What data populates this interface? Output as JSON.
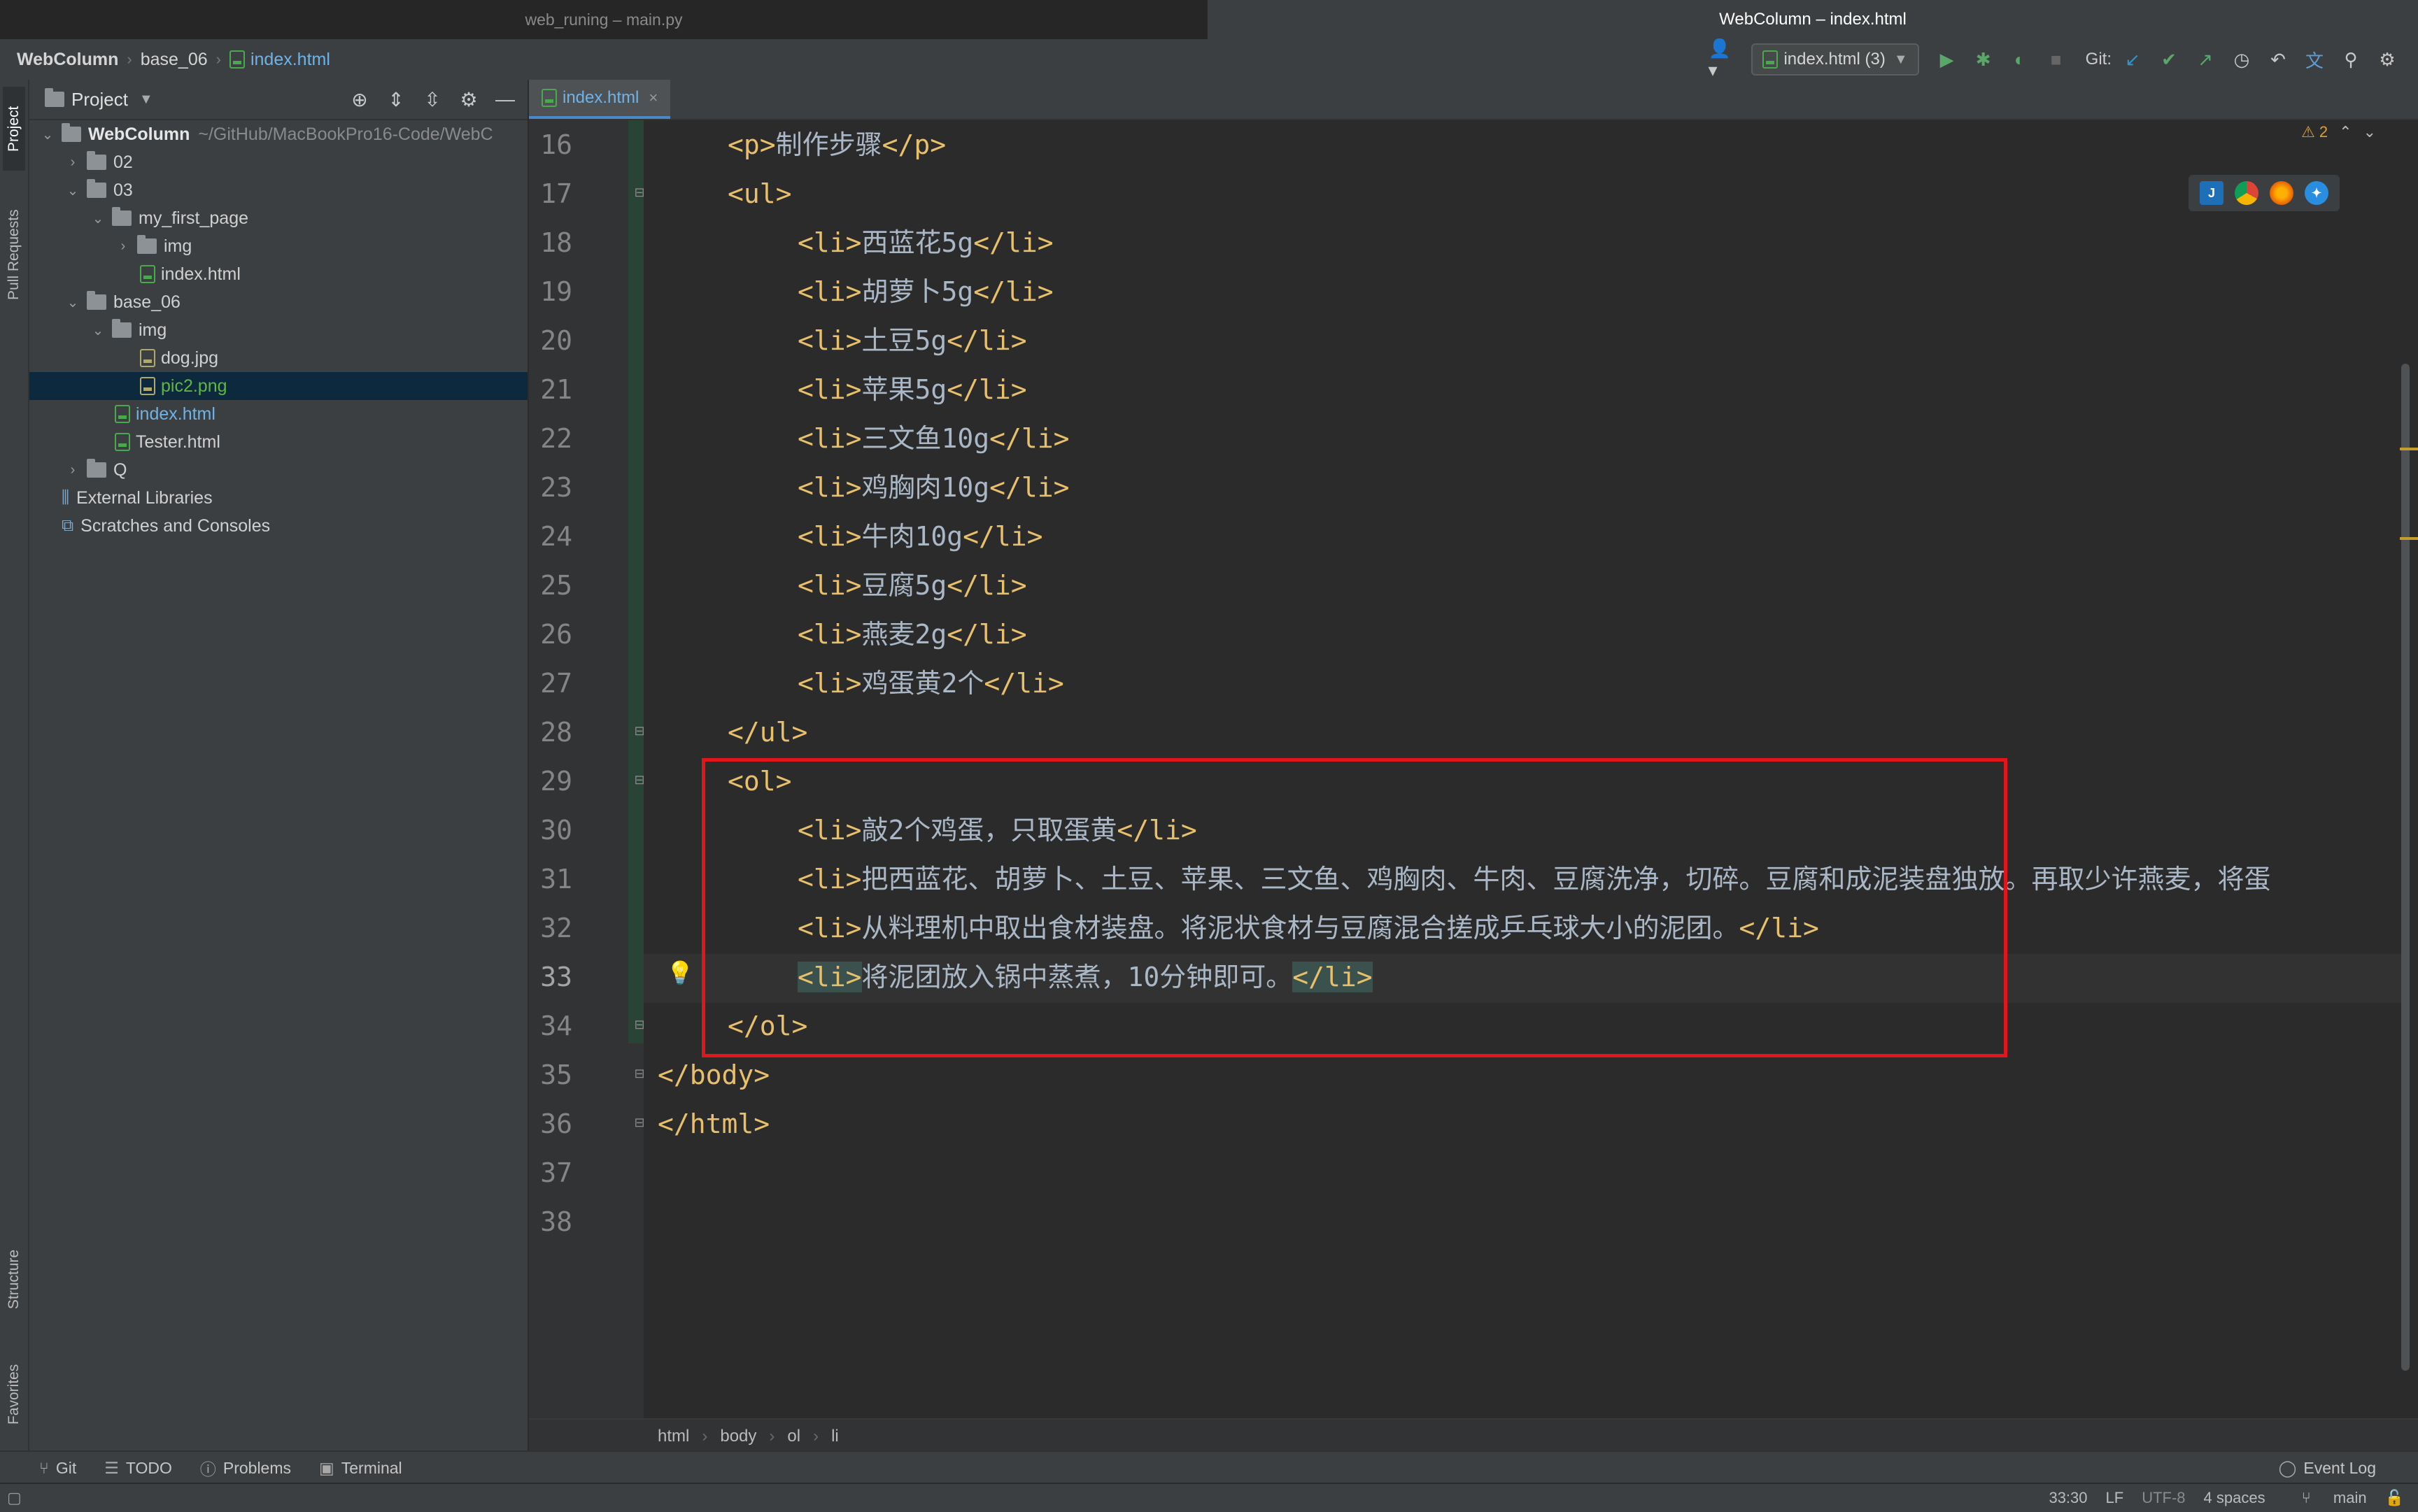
{
  "window": {
    "tab_left": "web_runing – main.py",
    "tab_right": "WebColumn – index.html"
  },
  "navbar": {
    "crumb_root": "WebColumn",
    "crumb_folder": "base_06",
    "crumb_file": "index.html",
    "run_config": "index.html (3)",
    "git_label": "Git:"
  },
  "leftstrip": {
    "project": "Project",
    "pull_requests": "Pull Requests",
    "structure": "Structure",
    "favorites": "Favorites"
  },
  "project_panel": {
    "title": "Project",
    "tree": [
      {
        "label": "WebColumn",
        "path": "~/GitHub/MacBookPro16-Code/WebC"
      },
      {
        "label": "02"
      },
      {
        "label": "03"
      },
      {
        "label": "my_first_page"
      },
      {
        "label": "img"
      },
      {
        "label": "index.html"
      },
      {
        "label": "base_06"
      },
      {
        "label": "img"
      },
      {
        "label": "dog.jpg"
      },
      {
        "label": "pic2.png"
      },
      {
        "label": "index.html"
      },
      {
        "label": "Tester.html"
      },
      {
        "label": "Q"
      },
      {
        "label": "External Libraries"
      },
      {
        "label": "Scratches and Consoles"
      }
    ]
  },
  "editor": {
    "tab_label": "index.html",
    "warnings_count": "2",
    "line_numbers": [
      "16",
      "17",
      "18",
      "19",
      "20",
      "21",
      "22",
      "23",
      "24",
      "25",
      "26",
      "27",
      "28",
      "29",
      "30",
      "31",
      "32",
      "33",
      "34",
      "35",
      "36",
      "37",
      "38"
    ],
    "lines": {
      "l16_open": "<p>",
      "l16_text": "制作步骤",
      "l16_close": "</p>",
      "l17": "<ul>",
      "li_open": "<li>",
      "li_close": "</li>",
      "l18": "西蓝花5g",
      "l19": "胡萝卜5g",
      "l20": "土豆5g",
      "l21": "苹果5g",
      "l22": "三文鱼10g",
      "l23": "鸡胸肉10g",
      "l24": "牛肉10g",
      "l25": "豆腐5g",
      "l26": "燕麦2g",
      "l27": "鸡蛋黄2个",
      "l28": "</ul>",
      "l29": "<ol>",
      "l30": "敲2个鸡蛋，只取蛋黄",
      "l31": "把西蓝花、胡萝卜、土豆、苹果、三文鱼、鸡胸肉、牛肉、豆腐洗净，切碎。豆腐和成泥装盘独放。再取少许燕麦，将蛋",
      "l32": "从料理机中取出食材装盘。将泥状食材与豆腐混合搓成乒乓球大小的泥团。",
      "l33": "将泥团放入锅中蒸煮，10分钟即可。",
      "l34": "</ol>",
      "l35": "</body>",
      "l36": "</html>"
    }
  },
  "editor_breadcrumbs": [
    "html",
    "body",
    "ol",
    "li"
  ],
  "toolstrip": {
    "git": "Git",
    "todo": "TODO",
    "problems": "Problems",
    "terminal": "Terminal",
    "event_log": "Event Log"
  },
  "statusbar": {
    "position": "33:30",
    "line_sep": "LF",
    "encoding": "UTF-8",
    "indent": "4 spaces",
    "branch": "main"
  },
  "colors": {
    "tag": "#e8bf6a",
    "text": "#a9b7c6",
    "highlight_box": "#e1161c",
    "selection": "#0d293e"
  }
}
